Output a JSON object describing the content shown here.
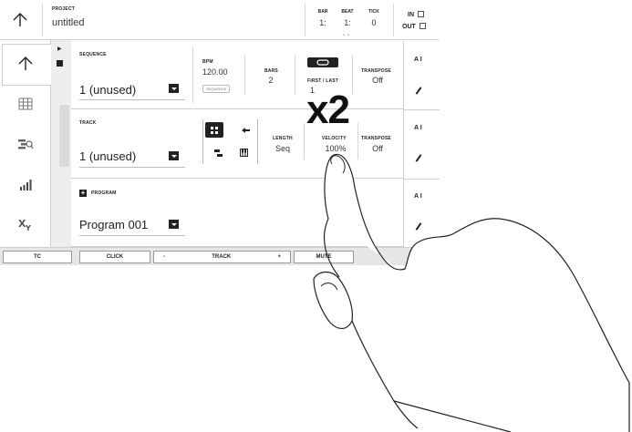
{
  "header": {
    "project_label": "PROJECT",
    "project_name": "untitled",
    "bar_label": "BAR",
    "bar_value": "1:",
    "beat_label": "BEAT",
    "beat_value": "1:",
    "tick_label": "TICK",
    "tick_value": "0",
    "page_dots": "• •",
    "in_label": "IN",
    "out_label": "OUT"
  },
  "sidebar": {
    "items": [
      {
        "icon": "home-icon"
      },
      {
        "icon": "grid-icon"
      },
      {
        "icon": "track-mixer-icon"
      },
      {
        "icon": "level-bars-icon"
      },
      {
        "icon": "xy-icon",
        "label": "XY"
      }
    ]
  },
  "sequence": {
    "title": "SEQUENCE",
    "value": "1 (unused)",
    "bpm_label": "BPM",
    "bpm_value": "120.00",
    "bpm_button": "SEQUENCE",
    "bars_label": "BARS",
    "bars_value": "2",
    "first_last_label": "FIRST / LAST",
    "first_value": "1",
    "transpose_label": "TRANSPOSE",
    "transpose_value": "Off"
  },
  "track": {
    "title": "TRACK",
    "value": "1 (unused)",
    "length_label": "LENGTH",
    "length_value": "Seq",
    "velocity_label": "VELOCITY",
    "velocity_value": "100%",
    "transpose_label": "TRANSPOSE",
    "transpose_value": "Off"
  },
  "program": {
    "title": "PROGRAM",
    "value": "Program 001"
  },
  "right_column": {
    "ai_label": "A I"
  },
  "bottom_bar": {
    "tc": "TC",
    "click": "CLICK",
    "minus": "-",
    "track": "TRACK",
    "plus": "+",
    "mute": "MUTE"
  },
  "overlay": {
    "gesture_text": "x2"
  }
}
